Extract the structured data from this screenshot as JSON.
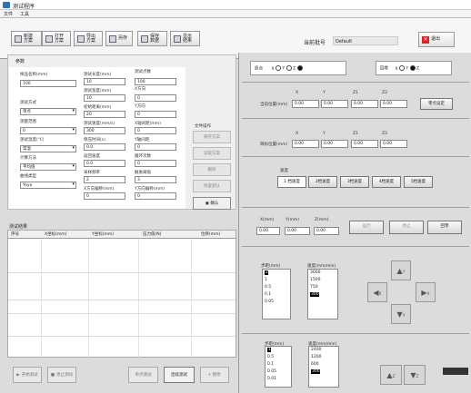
{
  "window": {
    "title": "测试程序"
  },
  "menu": [
    "文件",
    "工具"
  ],
  "toolbar": {
    "buttons": [
      "新建\n方案",
      "打开\n方案",
      "导出\n方案",
      "另存",
      "保存\n数据",
      "显示\n结果"
    ],
    "sample_label": "当前批号",
    "sample_value": "Default",
    "close_label": "退出"
  },
  "params": {
    "header": "参数",
    "fields": [
      {
        "label": "样品名称(mm)",
        "value": "100"
      },
      {
        "label": "测试方式",
        "value": "单点"
      },
      {
        "label": "测量范围",
        "value": "0"
      },
      {
        "label": "测试温度(℃)",
        "value": "常温"
      },
      {
        "label": "计算方法",
        "value": "平均值"
      },
      {
        "label": "曲线类型",
        "value": "Yoyo"
      }
    ],
    "mid_fields": [
      {
        "label": "测试长度(mm)",
        "value": "10"
      },
      {
        "label": "测试宽度(mm)",
        "value": "10"
      },
      {
        "label": "初始距离(mm)",
        "value": "20"
      },
      {
        "label": "测试速度(mm/s)",
        "value": "300"
      },
      {
        "label": "保压时间(s)",
        "value": "0.0"
      },
      {
        "label": "返回速度",
        "value": "0.0"
      },
      {
        "label": "采样频率",
        "value": "2"
      },
      {
        "label": "X方向偏移(mm)",
        "value": "0"
      }
    ],
    "right_fields": [
      {
        "label": "测试点数",
        "value": "100"
      },
      {
        "label": "X方向",
        "value": "0"
      },
      {
        "label": "Y方向",
        "value": "0"
      },
      {
        "label": "X轴间距(mm)",
        "value": "0"
      },
      {
        "label": "Y轴间距",
        "value": "0"
      },
      {
        "label": "循环次数",
        "value": "0"
      },
      {
        "label": "触发阈值",
        "value": "3"
      },
      {
        "label": "Y方向偏移(mm)",
        "value": "0"
      }
    ],
    "side_header": "文件操作",
    "side_buttons": [
      "保存方案",
      "读取方案",
      "删除",
      "恢复默认",
      "确认"
    ]
  },
  "results": {
    "header": "测试结果",
    "columns": [
      "序号",
      "X坐标(mm)",
      "Y坐标(mm)",
      "压力值(N)",
      "位移(mm)"
    ]
  },
  "bottom_buttons": [
    "开始测试",
    "停止测试",
    "单点测试",
    "连续测试",
    "暂停"
  ],
  "right": {
    "origin_label": "原点",
    "axes": [
      "X",
      "Y",
      "Z"
    ],
    "home_label": "回零",
    "pos_row1_label": "当前位置(mm)",
    "pos_headers": [
      "X",
      "Y",
      "Z1",
      "Z2"
    ],
    "pos_values": [
      "0.00",
      "0.00",
      "0.00",
      "0.00"
    ],
    "reset_label": "零点设定",
    "pos_row2_label": "目标位置(mm)",
    "pos_values2": [
      "0.00",
      "0.00",
      "0.00",
      "0.00"
    ],
    "pos_headers2": [
      "X",
      "Y",
      "Z1",
      "Z2"
    ],
    "speed_header": "速度",
    "speed_buttons": [
      "1 档速度",
      "2档速度",
      "3档速度",
      "4档速度",
      "5档速度"
    ],
    "coord_labels": [
      "X(mm)",
      "Y(mm)",
      "Z(mm)"
    ],
    "coord_values": [
      "0.00",
      "0.00",
      "0.00"
    ],
    "move_buttons": [
      "运行",
      "停止",
      "回零"
    ],
    "step_label": "步距(mm)",
    "step_values": [
      "2",
      "1",
      "0.5",
      "0.1",
      "0.05"
    ],
    "speed_label": "速度(mm/min)",
    "speed_values": [
      "3000",
      "1500",
      "750",
      "300"
    ],
    "arrow_up": "Y",
    "arrow_down": "Y",
    "arrow_left": "X",
    "arrow_right": "X",
    "z_step_label": "步距(mm)",
    "z_step_values": [
      "1",
      "0.5",
      "0.1",
      "0.05",
      "0.01"
    ],
    "z_speed_label": "速度(mm/min)",
    "z_speed_values": [
      "2400",
      "1200",
      "600",
      "300"
    ],
    "z_up": "Z",
    "z_down": "Z"
  }
}
